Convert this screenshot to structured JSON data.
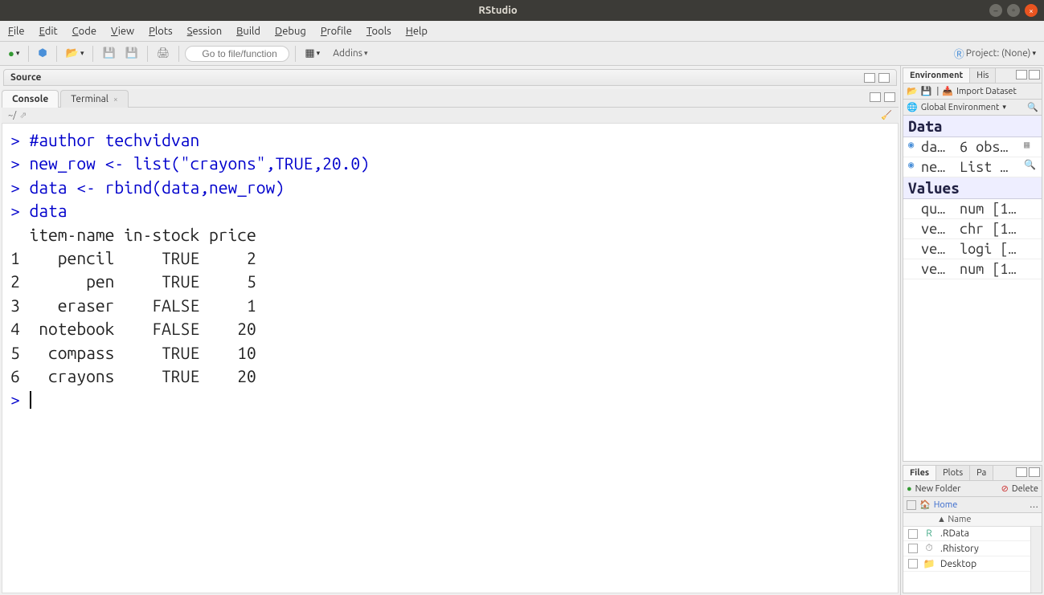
{
  "window": {
    "title": "RStudio"
  },
  "menubar": [
    "File",
    "Edit",
    "Code",
    "View",
    "Plots",
    "Session",
    "Build",
    "Debug",
    "Profile",
    "Tools",
    "Help"
  ],
  "toolbar": {
    "goto_placeholder": "Go to file/function",
    "addins": "Addins",
    "project_label": "Project: (None)"
  },
  "source": {
    "title": "Source"
  },
  "console": {
    "tabs": [
      "Console",
      "Terminal"
    ],
    "path": "~/",
    "lines": [
      {
        "type": "cmd",
        "text": "#author techvidvan"
      },
      {
        "type": "cmd",
        "text": "new_row <- list(\"crayons\",TRUE,20.0)"
      },
      {
        "type": "cmd",
        "text": "data <- rbind(data,new_row)"
      },
      {
        "type": "cmd",
        "text": "data"
      },
      {
        "type": "out",
        "text": "  item-name in-stock price"
      },
      {
        "type": "out",
        "text": "1    pencil     TRUE     2"
      },
      {
        "type": "out",
        "text": "2       pen     TRUE     5"
      },
      {
        "type": "out",
        "text": "3    eraser    FALSE     1"
      },
      {
        "type": "out",
        "text": "4  notebook    FALSE    20"
      },
      {
        "type": "out",
        "text": "5   compass     TRUE    10"
      },
      {
        "type": "out",
        "text": "6   crayons     TRUE    20"
      }
    ]
  },
  "env": {
    "tabs": [
      "Environment",
      "History"
    ],
    "import_label": "Import Dataset",
    "scope_label": "Global Environment",
    "sections": {
      "data_label": "Data",
      "values_label": "Values"
    },
    "data_rows": [
      {
        "name": "da…",
        "val": "6 obs…",
        "grid": true
      },
      {
        "name": "ne…",
        "val": "List …",
        "search": true
      }
    ],
    "value_rows": [
      {
        "name": "qu…",
        "val": "num [1…"
      },
      {
        "name": "ve…",
        "val": "chr [1…"
      },
      {
        "name": "ve…",
        "val": "logi […"
      },
      {
        "name": "ve…",
        "val": "num [1…"
      }
    ]
  },
  "files": {
    "tabs": [
      "Files",
      "Plots",
      "Packages"
    ],
    "tabs_short": [
      "Files",
      "Plots",
      "Pa"
    ],
    "new_folder": "New Folder",
    "delete": "Delete",
    "home": "Home",
    "name_header": "▲ Name",
    "rows": [
      {
        "icon": "R",
        "name": ".RData",
        "color": "#4a8"
      },
      {
        "icon": "⏱",
        "name": ".Rhistory",
        "color": "#888"
      },
      {
        "icon": "📁",
        "name": "Desktop",
        "color": "#e8b94a"
      }
    ]
  }
}
